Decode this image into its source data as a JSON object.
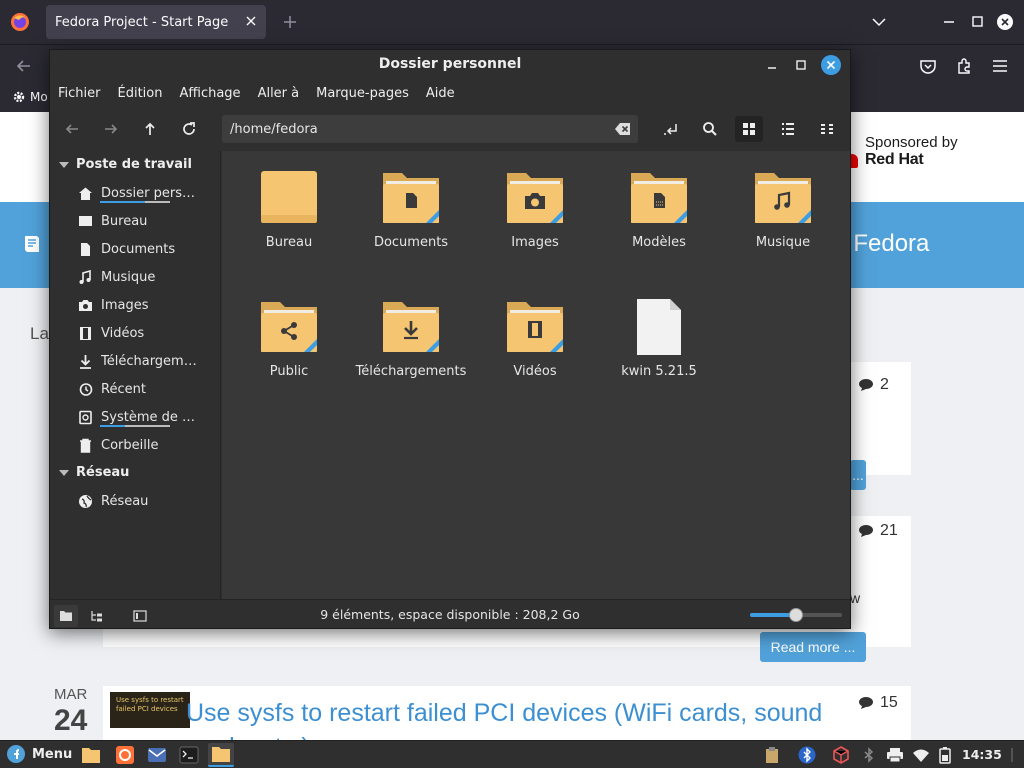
{
  "browser": {
    "tab_title": "Fedora Project - Start Page",
    "bookmarks_item": "Mo"
  },
  "page": {
    "sponsor_line1": "Sponsored by",
    "sponsor_line2": "Red Hat",
    "banner_text": "t Fedora",
    "la_text": "La",
    "comment_counts": [
      "2",
      "21",
      "15"
    ],
    "truncated_w": "w",
    "read_more_partial": "...",
    "read_more": "Read more ...",
    "date_month": "MAR",
    "date_day": "24",
    "thumb_text": "Use sysfs to restart failed PCI devices",
    "post_title": "Use sysfs to restart failed PCI devices (WiFi cards, sound",
    "post_title_line2": "cards, etc.)"
  },
  "file_manager": {
    "window_title": "Dossier personnel",
    "menu": [
      "Fichier",
      "Édition",
      "Affichage",
      "Aller à",
      "Marque-pages",
      "Aide"
    ],
    "path": "/home/fedora",
    "sidebar": {
      "sections": [
        {
          "title": "Poste de travail",
          "items": [
            {
              "label": "Dossier person...",
              "icon": "home-icon",
              "usage": 0.65
            },
            {
              "label": "Bureau",
              "icon": "desktop-icon"
            },
            {
              "label": "Documents",
              "icon": "document-icon"
            },
            {
              "label": "Musique",
              "icon": "music-icon"
            },
            {
              "label": "Images",
              "icon": "camera-icon"
            },
            {
              "label": "Vidéos",
              "icon": "film-icon"
            },
            {
              "label": "Téléchargeme...",
              "icon": "download-icon"
            },
            {
              "label": "Récent",
              "icon": "recent-icon"
            },
            {
              "label": "Système de fic...",
              "icon": "drive-icon",
              "usage": 0.35
            },
            {
              "label": "Corbeille",
              "icon": "trash-icon"
            }
          ]
        },
        {
          "title": "Réseau",
          "items": [
            {
              "label": "Réseau",
              "icon": "network-icon"
            }
          ]
        }
      ]
    },
    "files": [
      {
        "name": "Bureau",
        "icon": "folder-desktop-icon"
      },
      {
        "name": "Documents",
        "icon": "folder-documents-icon"
      },
      {
        "name": "Images",
        "icon": "folder-pictures-icon"
      },
      {
        "name": "Modèles",
        "icon": "folder-templates-icon"
      },
      {
        "name": "Musique",
        "icon": "folder-music-icon"
      },
      {
        "name": "Public",
        "icon": "folder-share-icon"
      },
      {
        "name": "Téléchargements",
        "icon": "folder-download-icon"
      },
      {
        "name": "Vidéos",
        "icon": "folder-videos-icon"
      },
      {
        "name": "kwin 5.21.5",
        "icon": "file-icon"
      }
    ],
    "status": "9 éléments, espace disponible : 208,2 Go",
    "zoom_level": 0.5
  },
  "taskbar": {
    "menu_label": "Menu",
    "clock": "14:35"
  },
  "colors": {
    "accent": "#3d9de3",
    "folder": "#f5c572",
    "fedora_blue": "#51a2da"
  }
}
